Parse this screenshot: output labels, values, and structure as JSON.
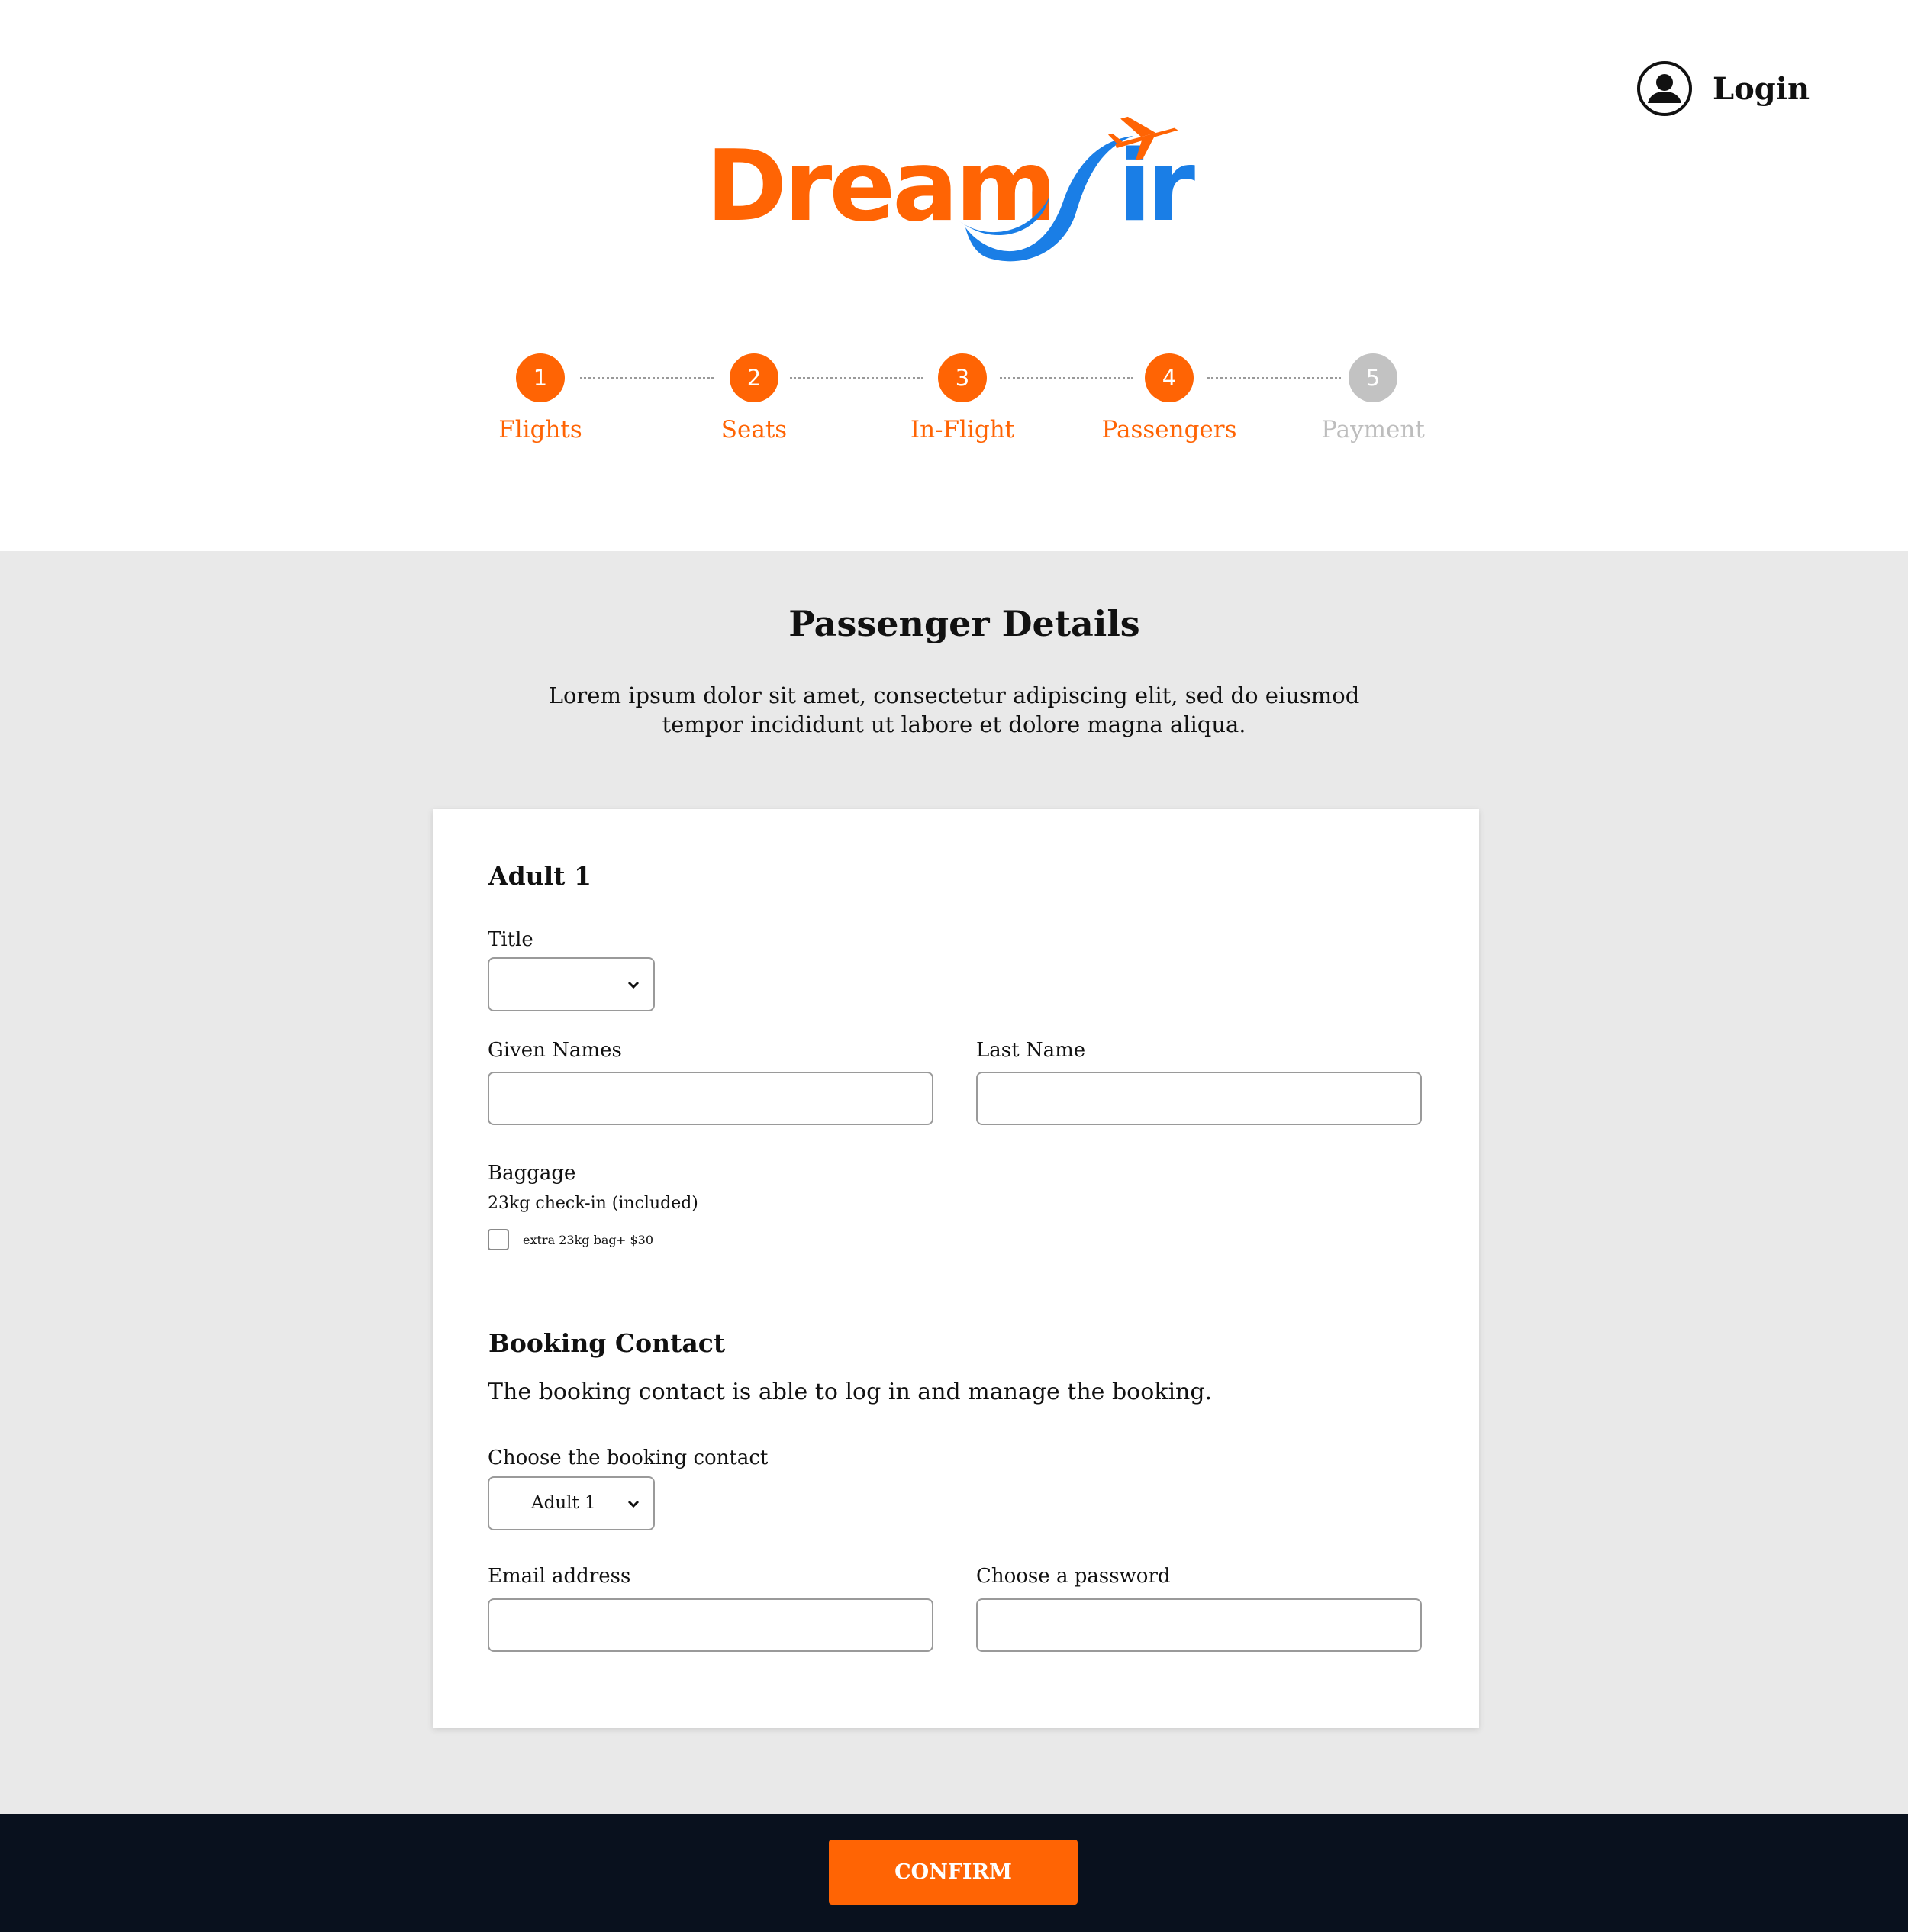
{
  "header": {
    "login_label": "Login",
    "logo_text_dream": "Dream",
    "logo_text_air": "ir"
  },
  "stepper": {
    "steps": [
      {
        "number": "1",
        "label": "Flights",
        "state": "done"
      },
      {
        "number": "2",
        "label": "Seats",
        "state": "done"
      },
      {
        "number": "3",
        "label": "In-Flight",
        "state": "done"
      },
      {
        "number": "4",
        "label": "Passengers",
        "state": "done"
      },
      {
        "number": "5",
        "label": "Payment",
        "state": "todo"
      }
    ]
  },
  "main": {
    "title": "Passenger Details",
    "intro_line1": "Lorem ipsum dolor sit amet, consectetur adipiscing elit, sed do eiusmod",
    "intro_line2": "tempor incididunt ut labore et dolore magna aliqua."
  },
  "passenger": {
    "heading": "Adult 1",
    "title_label": "Title",
    "title_value": "",
    "given_names_label": "Given Names",
    "given_names_value": "",
    "last_name_label": "Last Name",
    "last_name_value": "",
    "baggage_label": "Baggage",
    "baggage_included": "23kg check-in (included)",
    "extra_bag_label": "extra 23kg bag",
    "extra_bag_price": "+ $30",
    "extra_bag_checked": false
  },
  "contact": {
    "heading": "Booking Contact",
    "description": "The booking contact is able to log in and manage the booking.",
    "choose_label": "Choose the booking contact",
    "choose_value": "Adult 1",
    "email_label": "Email address",
    "email_value": "",
    "password_label": "Choose a password",
    "password_value": ""
  },
  "footer": {
    "confirm_label": "CONFIRM"
  },
  "colors": {
    "accent": "#ff6404",
    "logo_blue": "#1a7ee6",
    "step_inactive": "#c2c2c2",
    "main_bg": "#e9e9e9",
    "footer_bg": "#09111e"
  }
}
